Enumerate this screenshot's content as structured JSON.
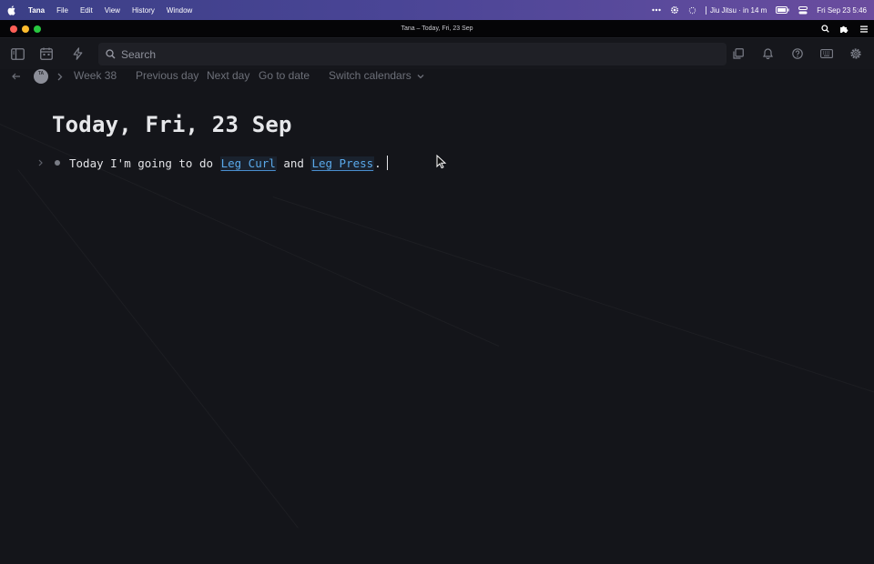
{
  "menubar": {
    "app_name": "Tana",
    "menus": [
      "File",
      "Edit",
      "View",
      "History",
      "Window"
    ],
    "event": "Jiu Jitsu · in 14 m",
    "datetime": "Fri Sep 23  5:46",
    "icons": [
      "apple-icon",
      "dots-icon",
      "gear-icon",
      "spinner-icon",
      "battery-icon",
      "control-center-icon",
      "search-icon",
      "extension-icon",
      "menu-icon"
    ]
  },
  "window": {
    "title": "Tana – Today, Fri, 23 Sep"
  },
  "toolbar": {
    "search_placeholder": "Search",
    "icons": [
      "sidebar-icon",
      "calendar-icon",
      "lightning-icon",
      "search-icon",
      "copy-icon",
      "bell-icon",
      "help-icon",
      "keyboard-icon",
      "settings-icon"
    ]
  },
  "nav": {
    "avatar_initials": "TA",
    "week": "Week 38",
    "previous_day": "Previous day",
    "next_day": "Next day",
    "go_to_date": "Go to date",
    "switch_calendars": "Switch calendars"
  },
  "page": {
    "title": "Today, Fri, 23 Sep",
    "node": {
      "text_before": "Today I'm going to do ",
      "ref1": "Leg Curl",
      "text_middle": " and ",
      "ref2": "Leg Press",
      "text_after": "."
    }
  },
  "colors": {
    "background": "#14151a",
    "link": "#5aa9ea",
    "menubar": "#4a4596"
  }
}
